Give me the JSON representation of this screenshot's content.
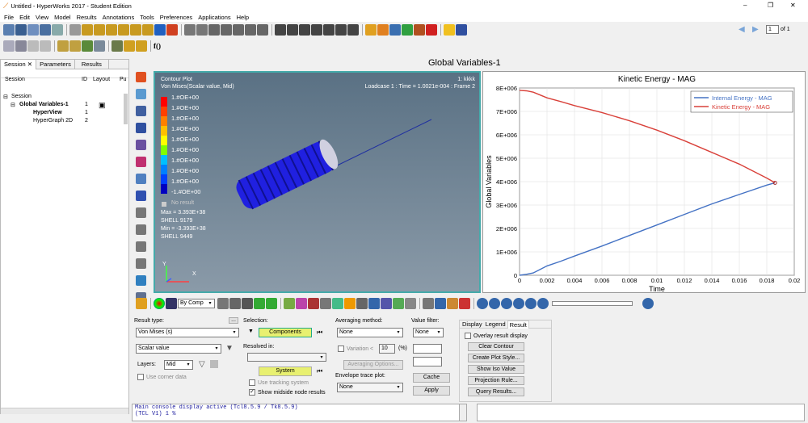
{
  "window": {
    "title": "Untitled - HyperWorks 2017 - Student Edition",
    "minimize": "–",
    "maximize": "❐",
    "close": "✕"
  },
  "menu": [
    "File",
    "Edit",
    "View",
    "Model",
    "Results",
    "Annotations",
    "Tools",
    "Preferences",
    "Applications",
    "Help"
  ],
  "toolbar": {
    "page_value": "1",
    "page_of": "of 1",
    "fx_label": "f()"
  },
  "session_tabs": [
    "Session",
    "Parameters",
    "Results"
  ],
  "session_table": {
    "headers": [
      "Session",
      "ID",
      "Layout",
      "Pu"
    ],
    "rows": [
      {
        "name": "Session",
        "id": "",
        "layout": ""
      },
      {
        "name": "Global Variables-1",
        "id": "1",
        "layout": "▣"
      },
      {
        "name": "HyperView",
        "id": "1",
        "layout": ""
      },
      {
        "name": "HyperGraph 2D",
        "id": "2",
        "layout": ""
      }
    ]
  },
  "page_title": "Global Variables-1",
  "contour": {
    "plot_label": "Contour Plot",
    "subtitle": "Von Mises(Scalar value, Mid)",
    "id_label": "1: kkkk",
    "loadcase": "Loadcase 1 : Time = 1.0021e-004 : Frame 2",
    "legend_values": [
      "1.#OE+00",
      "1.#OE+00",
      "1.#OE+00",
      "1.#OE+00",
      "1.#OE+00",
      "1.#OE+00",
      "1.#OE+00",
      "1.#OE+00",
      "1.#OE+00",
      "-1.#OE+00"
    ],
    "legend_colors": [
      "#ff0000",
      "#ff4000",
      "#ff8000",
      "#ffc000",
      "#ffff00",
      "#80ff00",
      "#00c0ff",
      "#0080ff",
      "#0040ff",
      "#0000c0"
    ],
    "no_result": "No result",
    "max": "Max = 3.393E+38",
    "max_elem": "SHELL 9179",
    "min": "Min = -3.393E+38",
    "min_elem": "SHELL 9449",
    "axis_y": "Y",
    "axis_x": "X"
  },
  "chart_data": {
    "type": "line",
    "title": "Kinetic Energy - MAG",
    "xlabel": "Time",
    "ylabel": "Global Variables",
    "xlim": [
      0,
      0.02
    ],
    "ylim": [
      0,
      8000000
    ],
    "x_ticks": [
      "0",
      "0.002",
      "0.004",
      "0.006",
      "0.008",
      "0.01",
      "0.012",
      "0.014",
      "0.016",
      "0.018",
      "0.02"
    ],
    "y_ticks": [
      "0",
      "1E+006",
      "2E+006",
      "3E+006",
      "4E+006",
      "5E+006",
      "6E+006",
      "7E+006",
      "8E+006"
    ],
    "legend_position": "top-right",
    "grid": true,
    "series": [
      {
        "name": "Internal Energy - MAG",
        "color": "#4472c4",
        "x": [
          0,
          0.0005,
          0.001,
          0.0015,
          0.002,
          0.003,
          0.004,
          0.006,
          0.008,
          0.01,
          0.012,
          0.014,
          0.016,
          0.018,
          0.0186
        ],
        "y": [
          0,
          40000,
          100000,
          250000,
          400000,
          600000,
          820000,
          1250000,
          1700000,
          2150000,
          2600000,
          3050000,
          3450000,
          3850000,
          3950000
        ]
      },
      {
        "name": "Kinetic Energy - MAG",
        "color": "#d9413a",
        "x": [
          0,
          0.0005,
          0.001,
          0.0015,
          0.002,
          0.003,
          0.004,
          0.006,
          0.008,
          0.01,
          0.012,
          0.014,
          0.016,
          0.018,
          0.0186
        ],
        "y": [
          7900000,
          7880000,
          7820000,
          7700000,
          7580000,
          7420000,
          7250000,
          6950000,
          6600000,
          6200000,
          5750000,
          5250000,
          4750000,
          4150000,
          3950000
        ]
      }
    ]
  },
  "viewbar": {
    "by_comp": "By Comp"
  },
  "result_panel": {
    "result_type_label": "Result type:",
    "result_type_value": "Von Mises (s)",
    "scalar_value": "Scalar value",
    "layers_label": "Layers:",
    "layers_value": "Mid",
    "use_corner_data": "Use corner data",
    "selection_label": "Selection:",
    "components_btn": "Components",
    "resolved_in_label": "Resolved in:",
    "system_btn": "System",
    "use_tracking": "Use tracking system",
    "show_midside": "Show midside node results",
    "averaging_label": "Averaging method:",
    "averaging_value": "None",
    "variation_label": "Variation <",
    "variation_value": "10",
    "variation_unit": "(%)",
    "averaging_options": "Averaging Options...",
    "envelope_label": "Envelope trace plot:",
    "envelope_value": "None",
    "value_filter_label": "Value filter:",
    "value_filter_value": "None",
    "cache_btn": "Cache",
    "apply_btn": "Apply",
    "tabs": [
      "Display",
      "Legend",
      "Result"
    ],
    "overlay": "Overlay result display",
    "buttons": [
      "Clear Contour",
      "Create Plot Style...",
      "Show Iso Value",
      "Projection Rule...",
      "Query Results..."
    ]
  },
  "console": {
    "line1": "Main console display active (Tcl8.5.9 / Tk8.5.9)",
    "line2": "(TCL V1) 1 %"
  }
}
